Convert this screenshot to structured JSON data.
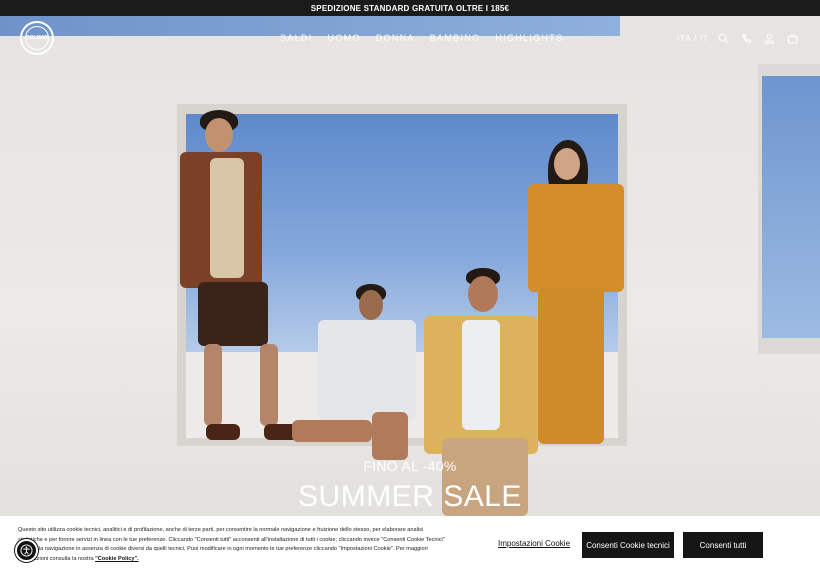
{
  "topbar": {
    "text": "SPEDIZIONE STANDARD GRATUITA OLTRE I 185€"
  },
  "header": {
    "logo_text": "COLMAR",
    "nav": [
      "SALDI",
      "UOMO",
      "DONNA",
      "BAMBINO",
      "HIGHLIGHTS"
    ],
    "locale": "ITA / IT",
    "icons": [
      "search-icon",
      "phone-icon",
      "account-icon",
      "bag-icon"
    ]
  },
  "hero": {
    "subtitle": "FINO AL -40%",
    "title": "SUMMER SALE"
  },
  "cookie": {
    "text": "Questo sito utilizza cookie tecnici, analitici e di profilazione, anche di terze parti, per consentire la normale navigazione e fruizione dello stesso, per elaborare analisi statistiche e per fornire servizi in linea con le tue preferenze. Cliccando \"Consenti tutti\" acconsenti all'installazione di tutti i cookie; cliccando invece \"Consenti Cookie Tecnici\" continui la navigazione in assenza di cookie diversi da quelli tecnici. Puoi modificare in ogni momento le tue preferenze cliccando \"Impostazioni Cookie\". Per maggiori informazioni consulta la nostra",
    "policy_link": "\"Cookie Policy\".",
    "settings_label": "Impostazioni Cookie",
    "technical_label": "Consenti Cookie tecnici",
    "all_label": "Consenti tutti"
  },
  "colors": {
    "topbar_bg": "#1b1b1b",
    "button_bg": "#161616",
    "text_on_dark": "#ffffff"
  }
}
